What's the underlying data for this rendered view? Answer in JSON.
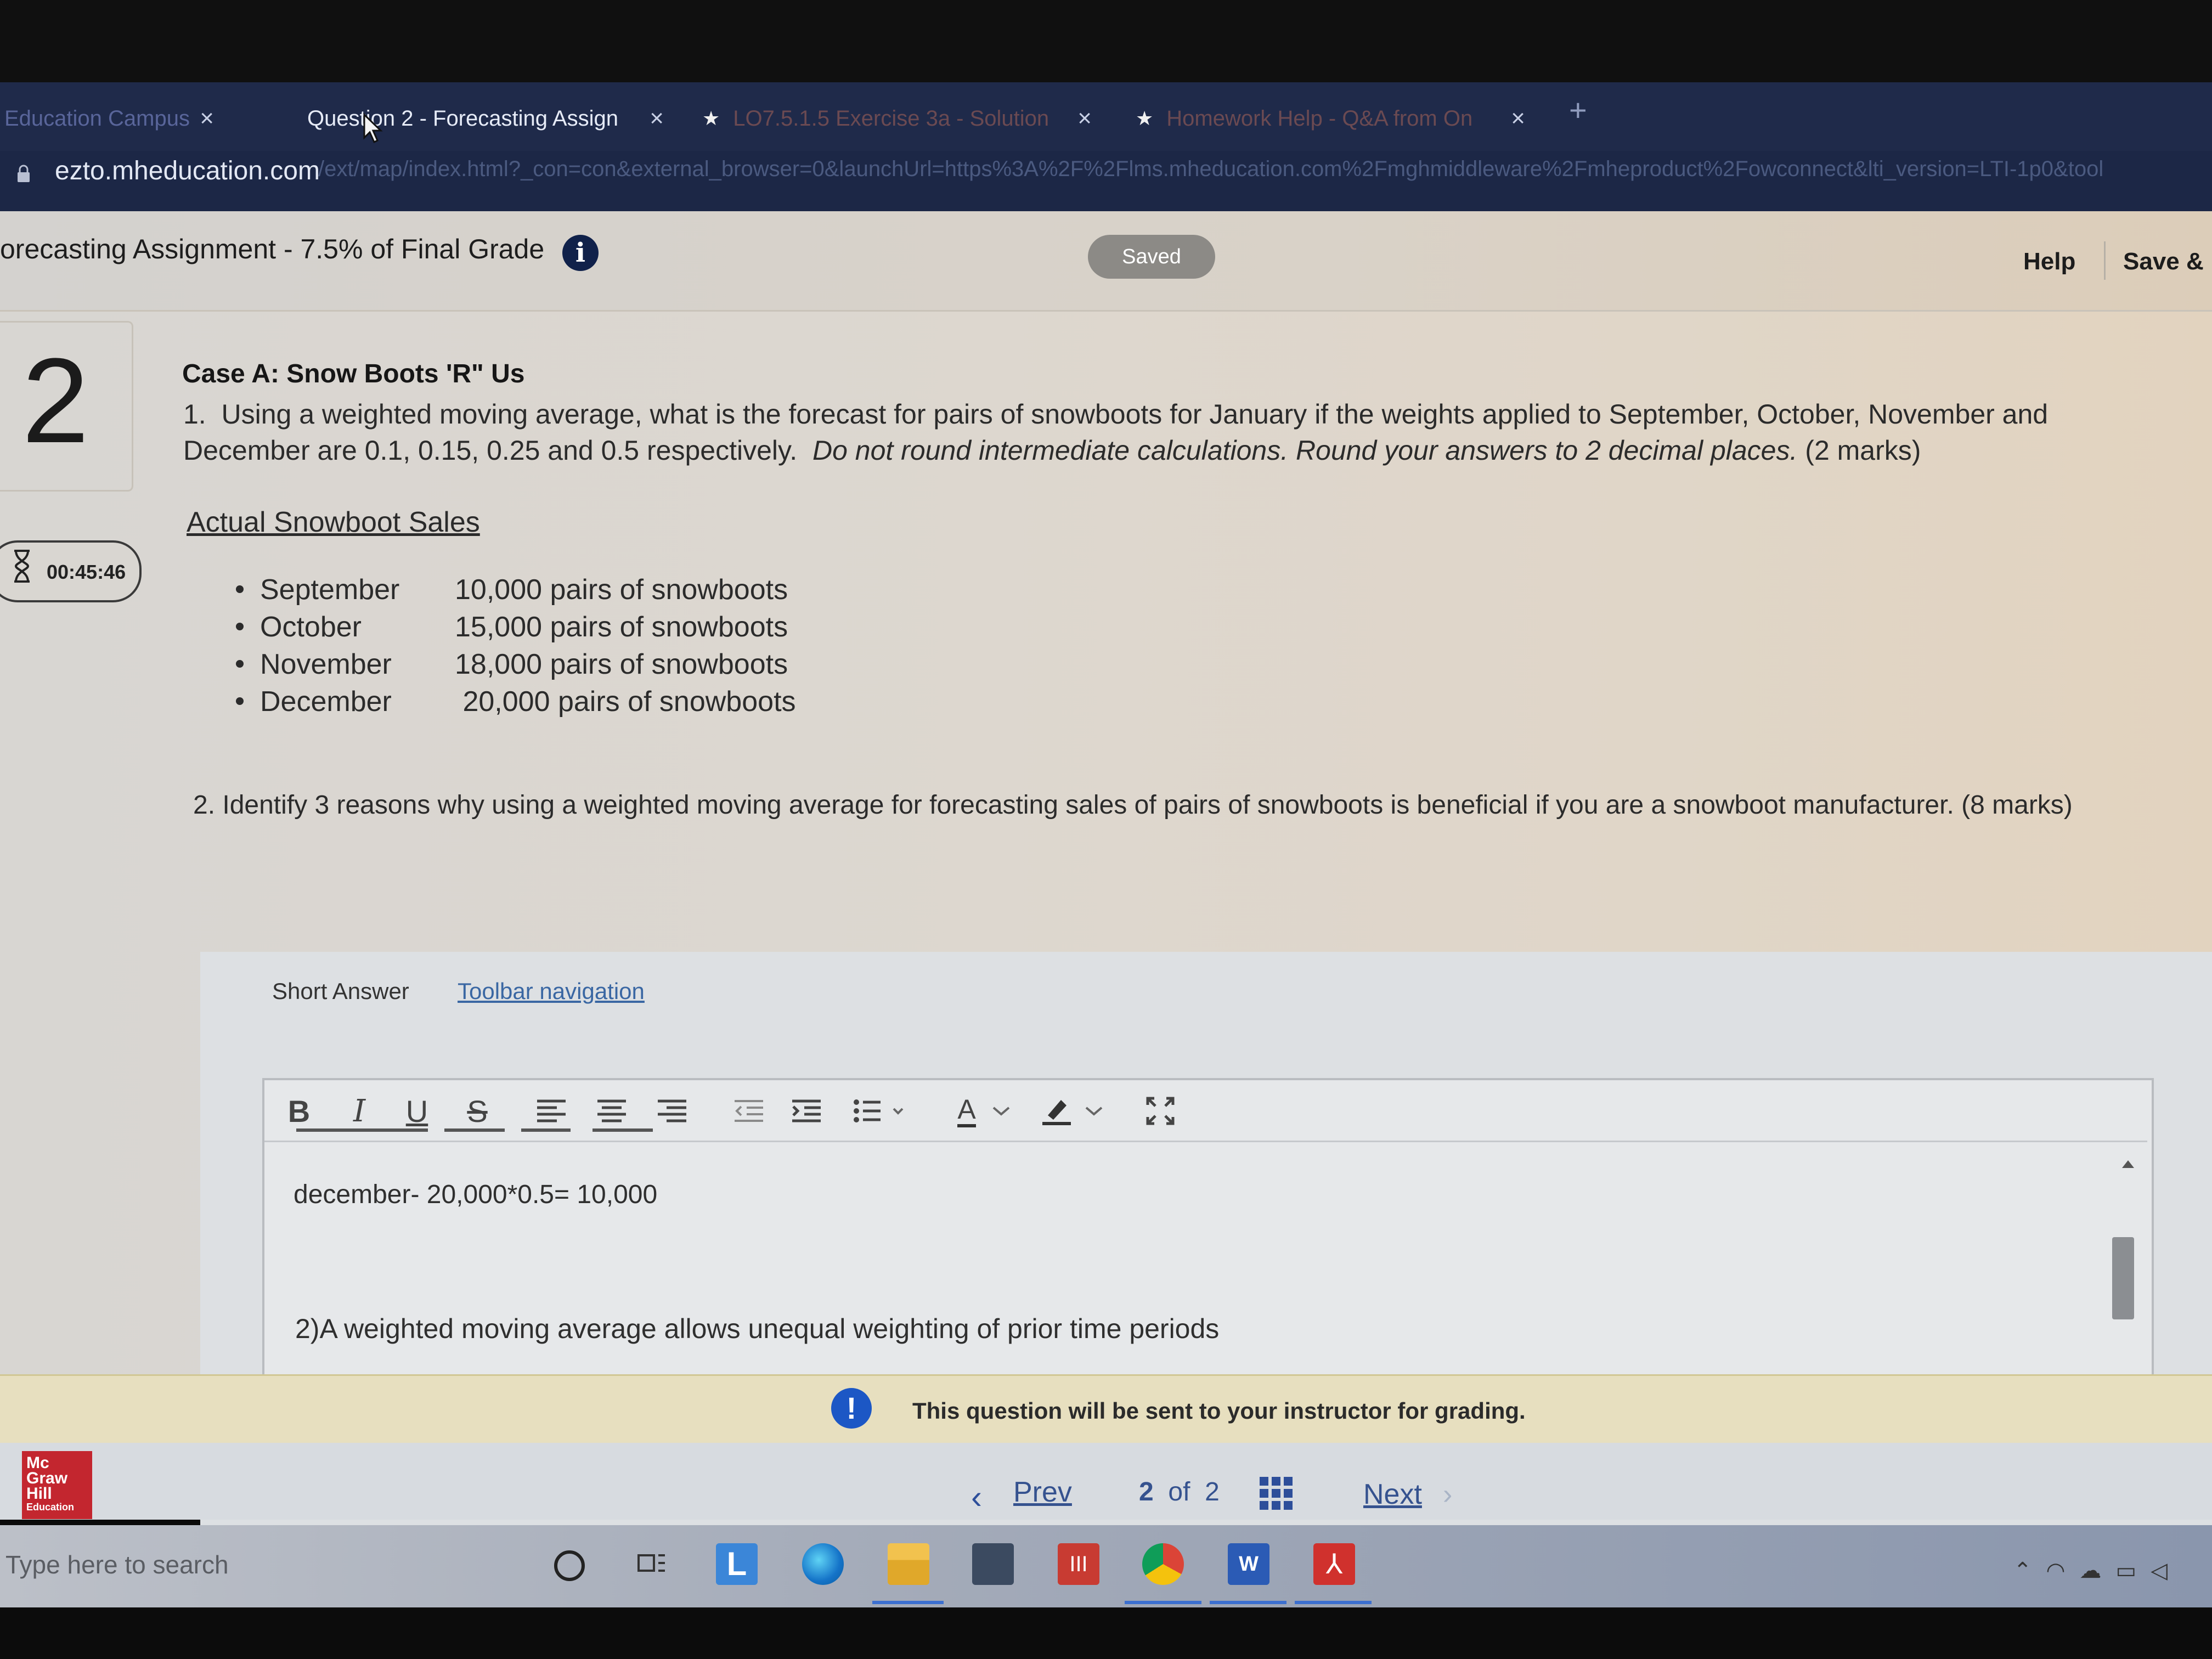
{
  "browser": {
    "tabs": [
      {
        "label": "Education Campus",
        "active": false,
        "starred": false
      },
      {
        "label": "Question 2 - Forecasting Assign",
        "active": true,
        "starred": false
      },
      {
        "label": "LO7.5.1.5 Exercise 3a - Solution",
        "active": false,
        "starred": true
      },
      {
        "label": "Homework Help - Q&A from On",
        "active": false,
        "starred": true
      }
    ],
    "close_glyph": "×",
    "new_tab_glyph": "+",
    "url": "ezto.mheducation.com",
    "url_rest": "/ext/map/index.html?_con=con&external_browser=0&launchUrl=https%3A%2F%2Flms.mheducation.com%2Fmghmiddleware%2Fmheproduct%2Fowconnect&lti_version=LTI-1p0&tool"
  },
  "header": {
    "title": "orecasting Assignment - 7.5% of Final Grade",
    "info_glyph": "i",
    "saved_label": "Saved",
    "help_label": "Help",
    "save_exit_label": "Save &"
  },
  "question": {
    "number": "2",
    "timer": "00:45:46",
    "case_title": "Case A: Snow Boots 'R\" Us",
    "q1_prefix": "1.",
    "q1_text": "Using a weighted moving average, what is the forecast for pairs of snowboots for January if the weights applied to September, October, November and December are 0.1, 0.15, 0.25 and 0.5 respectively.",
    "q1_italic": "Do not round intermediate calculations.  Round your answers to 2 decimal places.",
    "q1_marks": "(2 marks)",
    "sales_heading": "Actual Snowboot Sales",
    "sales": [
      {
        "month": "September",
        "value": "10,000 pairs of snowboots"
      },
      {
        "month": "October",
        "value": "15,000 pairs of snowboots"
      },
      {
        "month": "November",
        "value": "18,000 pairs of snowboots"
      },
      {
        "month": "December",
        "value": " 20,000 pairs of snowboots"
      }
    ],
    "q2_text": "2. Identify 3 reasons why using a weighted moving average for forecasting sales of pairs of snowboots is beneficial if you are a snowboot manufacturer. (8 marks)"
  },
  "answer": {
    "type_label": "Short Answer",
    "toolbar_nav_label": "Toolbar navigation",
    "toolbar": {
      "bold": "B",
      "italic": "I",
      "underline": "U",
      "strike": "S",
      "font_color": "A"
    },
    "line1": "december- 20,000*0.5= 10,000",
    "line2": "2)A weighted moving average allows unequal weighting of prior time periods"
  },
  "notice": {
    "icon_glyph": "!",
    "text": "This question will be sent to your instructor for grading."
  },
  "footer": {
    "logo_lines": [
      "Mc",
      "Graw",
      "Hill",
      "Education"
    ],
    "prev_label": "Prev",
    "page_current": "2",
    "page_of": "of",
    "page_total": "2",
    "next_label": "Next",
    "prev_glyph": "‹",
    "next_glyph": "›"
  },
  "taskbar": {
    "search_placeholder": "Type here to search",
    "launcher_letter": "L",
    "word_letter": "W",
    "red_app_glyph": "III",
    "acrobat_glyph": "⅄"
  },
  "colors": {
    "link_blue": "#35528f",
    "notice_blue": "#1c57c5",
    "mh_red": "#c3262f",
    "tab_bar": "#1f2a4a"
  }
}
